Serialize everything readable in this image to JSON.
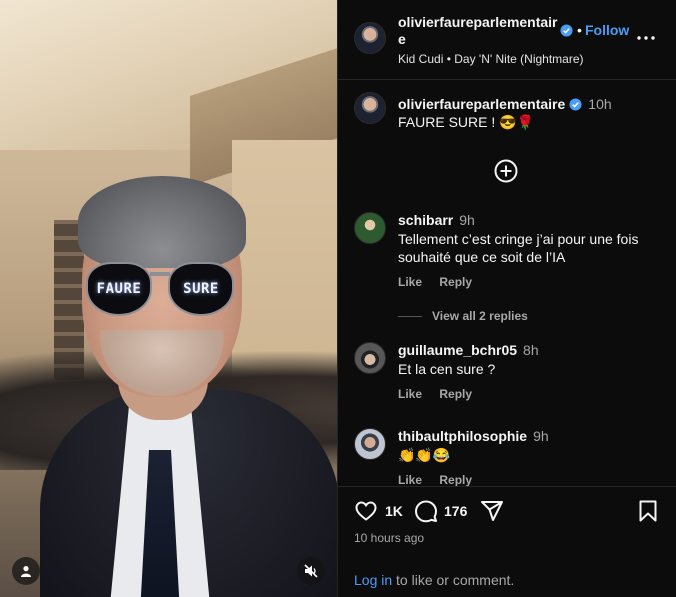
{
  "media": {
    "lens_left_text": "FAURE",
    "lens_right_text": "SURE",
    "user_icon": "user-icon",
    "mute_icon": "muted-speaker-icon"
  },
  "header": {
    "username": "olivierfaureparlementaire",
    "verified_icon": "verified-badge-icon",
    "separator": "•",
    "follow_label": "Follow",
    "more_icon": "more-options-icon",
    "audio": "Kid Cudi • Day 'N' Nite (Nightmare)"
  },
  "caption": {
    "username": "olivierfaureparlementaire",
    "time": "10h",
    "text": "FAURE SURE ! 😎🌹"
  },
  "add_icon": "add-circle-icon",
  "comments": [
    {
      "username": "schibarr",
      "time": "9h",
      "text": "Tellement c’est cringe j’ai pour une fois souhaité que ce soit de l’IA",
      "like_label": "Like",
      "reply_label": "Reply",
      "view_replies": "View all 2 replies"
    },
    {
      "username": "guillaume_bchr05",
      "time": "8h",
      "text": "Et la cen sure ?",
      "like_label": "Like",
      "reply_label": "Reply"
    },
    {
      "username": "thibaultphilosophie",
      "time": "9h",
      "text": "👏👏😂",
      "like_label": "Like",
      "reply_label": "Reply"
    }
  ],
  "footer": {
    "like_icon": "heart-icon",
    "likes": "1K",
    "comment_icon": "comment-icon",
    "comments": "176",
    "share_icon": "share-icon",
    "save_icon": "bookmark-icon",
    "posted": "10 hours ago",
    "login_link": "Log in",
    "login_text": " to like or comment."
  },
  "colors": {
    "accent": "#4a9cf5",
    "background": "#0c0c0c",
    "secondary_text": "#a8a8a8"
  }
}
